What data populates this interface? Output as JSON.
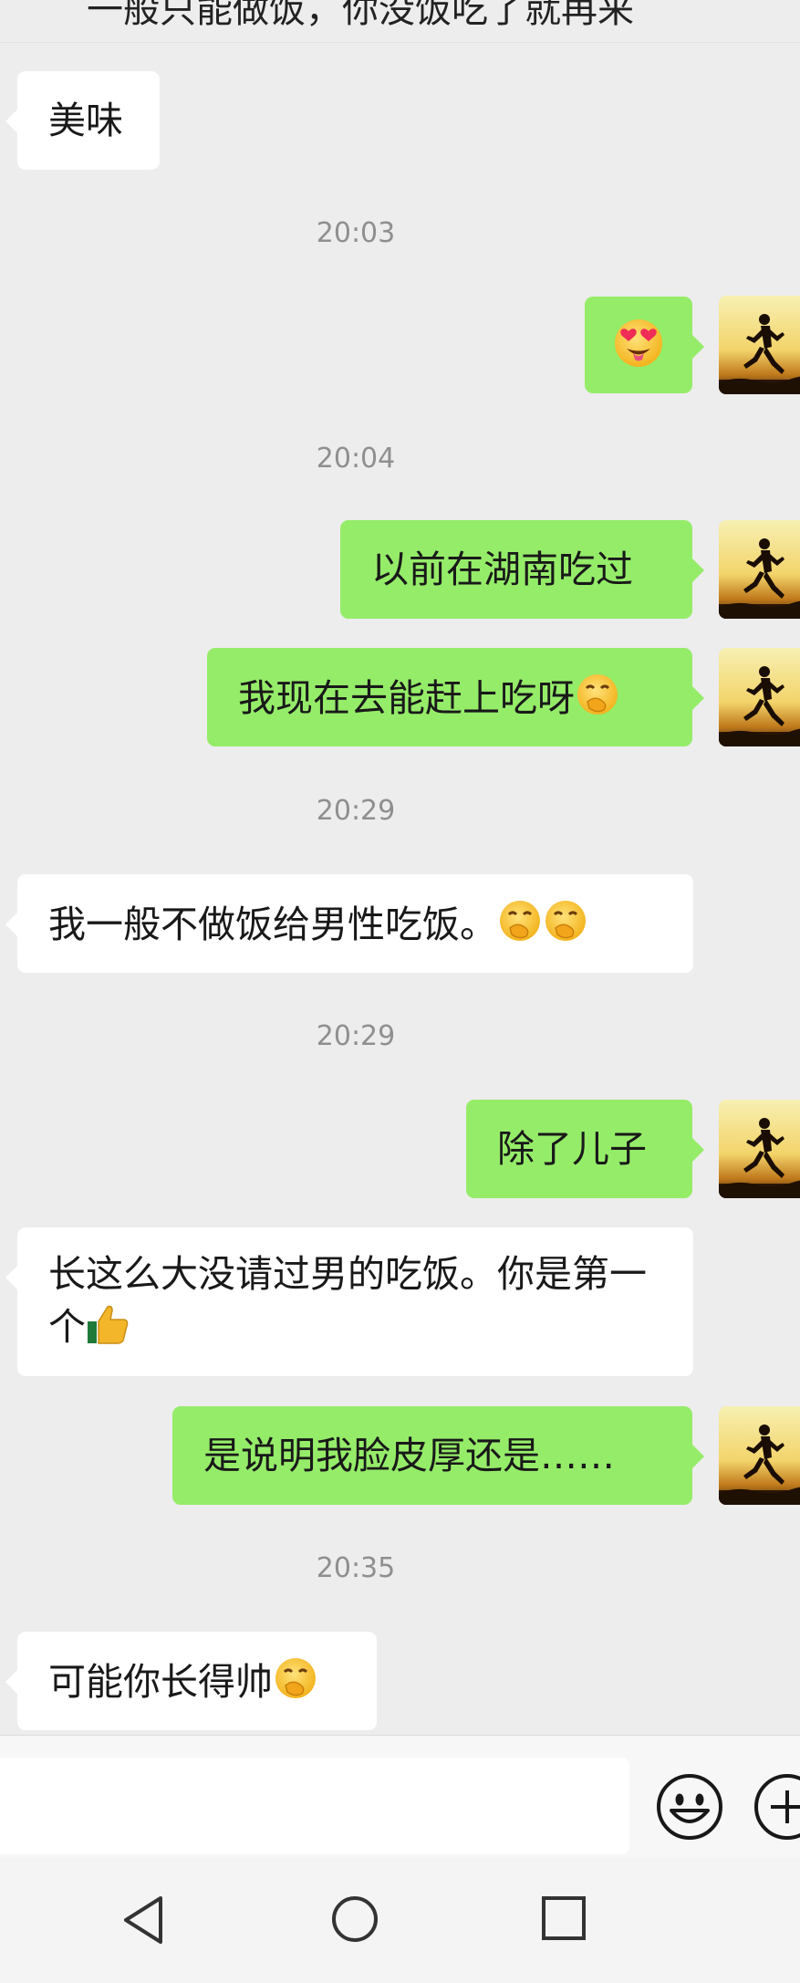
{
  "header": {
    "partial_title": "一般只能做饭，你没饭吃了就再来"
  },
  "messages": [
    {
      "type": "in",
      "text": "美味"
    },
    {
      "type": "time",
      "text": "20:03"
    },
    {
      "type": "out",
      "emoji": "star-struck-emoji"
    },
    {
      "type": "time",
      "text": "20:04"
    },
    {
      "type": "out",
      "text": "以前在湖南吃过"
    },
    {
      "type": "out",
      "text": "我现在去能赶上吃呀",
      "emoji": "hand-over-mouth-emoji"
    },
    {
      "type": "time",
      "text": "20:29"
    },
    {
      "type": "in",
      "text": "我一般不做饭给男性吃饭。",
      "emoji": "hand-over-mouth-emoji x2"
    },
    {
      "type": "time",
      "text": "20:29"
    },
    {
      "type": "out",
      "text": "除了儿子"
    },
    {
      "type": "in",
      "text": "长这么大没请过男的吃饭。你是第一个",
      "emoji": "thumbs-up-emoji"
    },
    {
      "type": "out",
      "text": "是说明我脸皮厚还是……"
    },
    {
      "type": "time",
      "text": "20:35"
    },
    {
      "type": "in",
      "text": "可能你长得帅",
      "emoji": "hand-over-mouth-emoji"
    }
  ],
  "input": {
    "placeholder": ""
  },
  "icons": {
    "emoji_button": "smiley-icon",
    "plus_button": "plus-circle-icon",
    "nav_back": "back-triangle-icon",
    "nav_home": "home-circle-icon",
    "nav_recents": "recents-square-icon"
  },
  "colors": {
    "background": "#ededed",
    "incoming_bubble": "#ffffff",
    "outgoing_bubble": "#95ec69",
    "timestamp": "#8f8f8f",
    "text": "#191919"
  }
}
